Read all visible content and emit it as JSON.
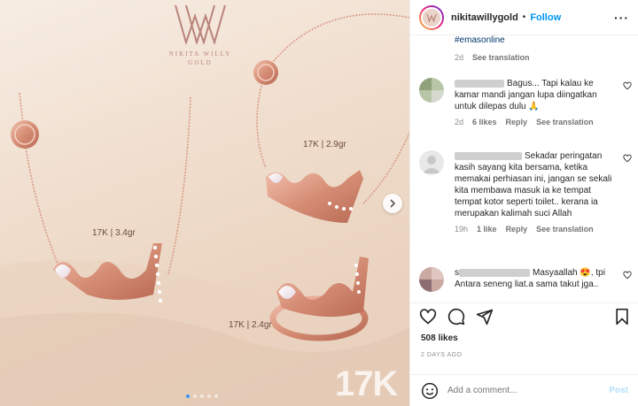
{
  "media": {
    "brand_name_line1": "NIKITA WILLY",
    "brand_name_line2": "GOLD",
    "label_necklace": "17K | 3.4gr",
    "label_bracelet": "17K | 2.9gr",
    "label_ring": "17K | 2.4gr",
    "watermark": "17K",
    "slides_total": 5,
    "active_slide": 1,
    "next_icon": "chevron-right-icon"
  },
  "header": {
    "username": "nikitawillygold",
    "separator": "•",
    "follow_label": "Follow",
    "more_label": "···"
  },
  "caption": {
    "hashtag": "#emasonline",
    "age": "2d",
    "see_translation": "See translation"
  },
  "comments": [
    {
      "text": "Bagus... Tapi kalau ke kamar mandi jangan lupa diingatkan untuk dilepas dulu 🙏",
      "age": "2d",
      "likes": "6 likes",
      "reply": "Reply",
      "see_translation": "See translation"
    },
    {
      "text": "Sekadar peringatan kasih sayang kita bersama, ketika memakai perhiasan ini, jangan se sekali kita membawa masuk ia ke tempat tempat kotor seperti toilet.. kerana ia merupakan kalimah suci Allah",
      "age": "19h",
      "likes": "1 like",
      "reply": "Reply",
      "see_translation": "See translation"
    },
    {
      "prefix": "s",
      "text": "Masyaallah 😍, tpi Antara seneng liat.a sama takut jga..",
      "age": "",
      "likes": "",
      "reply": "",
      "see_translation": ""
    }
  ],
  "actions": {
    "like_icon": "heart-icon",
    "comment_icon": "comment-icon",
    "share_icon": "share-icon",
    "save_icon": "bookmark-icon"
  },
  "likes": "508 likes",
  "date": "2 DAYS AGO",
  "add_comment": {
    "placeholder": "Add a comment...",
    "post_label": "Post"
  },
  "colors": {
    "accent": "#0095f6",
    "rose_gold": "#d99a86",
    "background_sand": "#efdccb"
  }
}
